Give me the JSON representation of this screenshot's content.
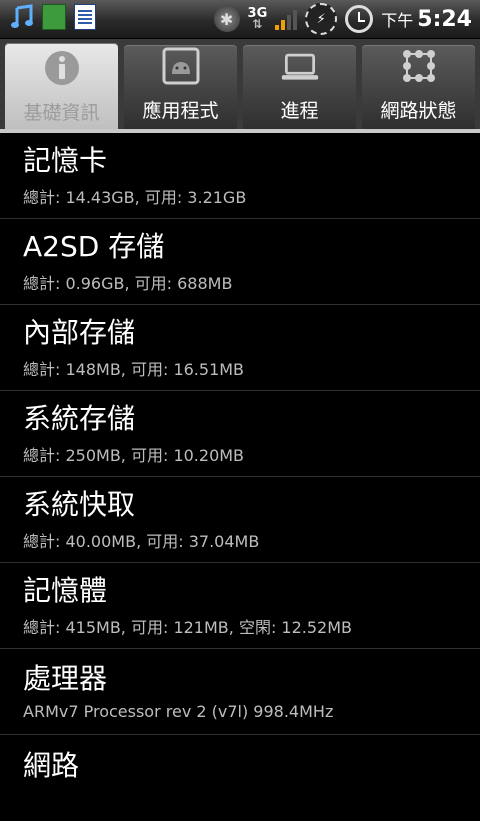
{
  "status_bar": {
    "left_icons": [
      "music-icon",
      "sheet-icon",
      "doc-icon"
    ],
    "network_type": "3G",
    "network_arrows": "⇅",
    "battery_symbol": "⚡",
    "ampm": "下午",
    "time": "5:24",
    "signal_color": "#f0a000"
  },
  "tabs": [
    {
      "label": "基礎資訊",
      "icon": "info-icon",
      "active": true
    },
    {
      "label": "應用程式",
      "icon": "android-icon",
      "active": false
    },
    {
      "label": "進程",
      "icon": "laptop-icon",
      "active": false
    },
    {
      "label": "網路狀態",
      "icon": "network-icon",
      "active": false
    }
  ],
  "items": [
    {
      "title": "記憶卡",
      "subtitle": "總計: 14.43GB, 可用: 3.21GB"
    },
    {
      "title": "A2SD 存儲",
      "subtitle": "總計: 0.96GB, 可用: 688MB"
    },
    {
      "title": "內部存儲",
      "subtitle": "總計: 148MB, 可用: 16.51MB"
    },
    {
      "title": "系統存儲",
      "subtitle": "總計: 250MB, 可用: 10.20MB"
    },
    {
      "title": "系統快取",
      "subtitle": "總計: 40.00MB, 可用: 37.04MB"
    },
    {
      "title": "記憶體",
      "subtitle": "總計: 415MB, 可用: 121MB, 空閑: 12.52MB"
    },
    {
      "title": "處理器",
      "subtitle": "ARMv7 Processor rev 2 (v7l)  998.4MHz"
    },
    {
      "title": "網路",
      "subtitle": ""
    }
  ]
}
